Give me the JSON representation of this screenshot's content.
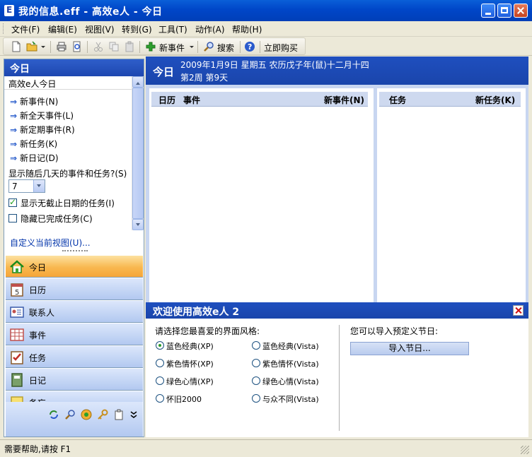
{
  "window": {
    "title": "我的信息.eff - 高效e人 - 今日"
  },
  "menu": [
    "文件(F)",
    "编辑(E)",
    "视图(V)",
    "转到(G)",
    "工具(T)",
    "动作(A)",
    "帮助(H)"
  ],
  "toolbar": {
    "new_event": "新事件",
    "search": "搜索",
    "buy_now": "立即购买"
  },
  "left_panel": {
    "header": "今日",
    "subheader": "高效e人今日",
    "actions": [
      "新事件(N)",
      "新全天事件(L)",
      "新定期事件(R)",
      "新任务(K)",
      "新日记(D)"
    ],
    "show_days_label": "显示随后几天的事件和任务?(S)",
    "days_value": "7",
    "show_undated_label": "显示无截止日期的任务(I)",
    "show_undated_checked": true,
    "hide_completed_label": "隐藏已完成任务(C)",
    "hide_completed_checked": false,
    "customize_link": "自定义当前视图(U)..."
  },
  "nav": {
    "today": "今日",
    "calendar": "日历",
    "contacts": "联系人",
    "events": "事件",
    "tasks": "任务",
    "diary": "日记",
    "memo": "备忘"
  },
  "today_header": {
    "title": "今日",
    "date_line": "2009年1月9日 星期五 农历戊子年(鼠)十二月十四",
    "week_line": "第2周 第9天"
  },
  "columns": {
    "calendar": "日历",
    "events": "事件",
    "new_event": "新事件(N)",
    "tasks": "任务",
    "new_task": "新任务(K)"
  },
  "welcome": {
    "title": "欢迎使用高效e人 2",
    "theme_prompt": "请选择您最喜爱的界面风格:",
    "themes": [
      "蓝色经典(XP)",
      "紫色情怀(XP)",
      "绿色心情(XP)",
      "怀旧2000",
      "蓝色经典(Vista)",
      "紫色情怀(Vista)",
      "绿色心情(Vista)",
      "与众不同(Vista)"
    ],
    "holiday_prompt": "您可以导入预定义节日:",
    "import_button": "导入节日..."
  },
  "status": {
    "text": "需要帮助,请按 F1"
  },
  "colors": {
    "title_blue": "#0046c8",
    "nav_active": "#f8b850",
    "header_blue": "#1f4fbf"
  }
}
